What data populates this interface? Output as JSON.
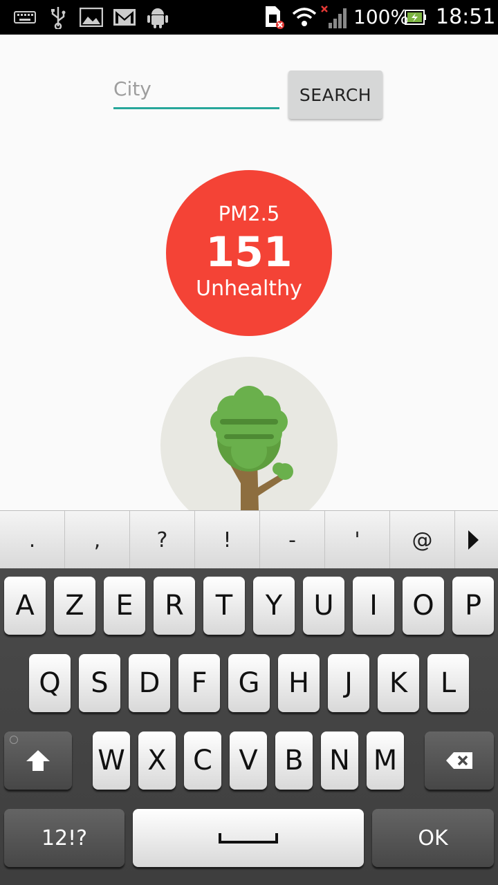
{
  "status_bar": {
    "battery": "100%",
    "time": "18:51"
  },
  "search": {
    "placeholder": "City",
    "value": "",
    "button_label": "SEARCH"
  },
  "aqi": {
    "label": "PM2.5",
    "value": "151",
    "status": "Unhealthy",
    "color": "#f44336"
  },
  "keyboard": {
    "suggestions": [
      ".",
      ",",
      "?",
      "!",
      "-",
      "'",
      "@"
    ],
    "rows": [
      [
        "A",
        "Z",
        "E",
        "R",
        "T",
        "Y",
        "U",
        "I",
        "O",
        "P"
      ],
      [
        "Q",
        "S",
        "D",
        "F",
        "G",
        "H",
        "J",
        "K",
        "L"
      ],
      [
        "W",
        "X",
        "C",
        "V",
        "B",
        "N",
        "M"
      ]
    ],
    "mode_key": "12!?",
    "ok_key": "OK"
  }
}
